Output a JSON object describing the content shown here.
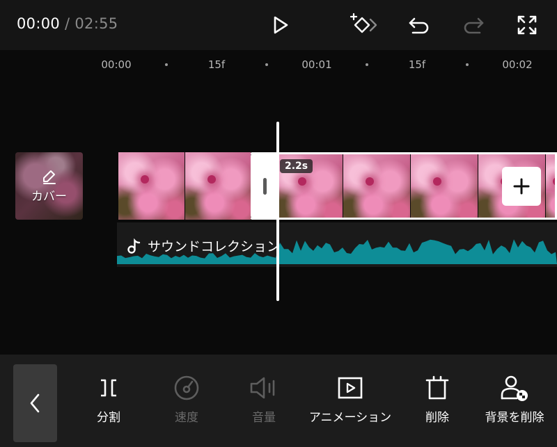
{
  "header": {
    "current_time": "00:00",
    "separator": "/",
    "total_time": "02:55",
    "icons": [
      "play-icon",
      "add-keyframe-icon",
      "undo-icon",
      "redo-icon",
      "fullscreen-icon"
    ]
  },
  "ruler": {
    "labels": [
      "00:00",
      "15f",
      "00:01",
      "15f",
      "00:02"
    ]
  },
  "cover": {
    "label": "カバー",
    "icon": "edit-pencil-icon"
  },
  "video": {
    "duration_badge": "2.2s",
    "add_icon": "plus-icon"
  },
  "audio": {
    "label": "サウンドコレクション",
    "icon": "music-note-icon",
    "wave_color": "#0e8d97"
  },
  "toolbar": {
    "back_icon": "chevron-left-icon",
    "items": [
      {
        "label": "分割",
        "icon": "split-icon",
        "enabled": true
      },
      {
        "label": "速度",
        "icon": "speed-icon",
        "enabled": false
      },
      {
        "label": "音量",
        "icon": "volume-icon",
        "enabled": false
      },
      {
        "label": "アニメーション",
        "icon": "animation-icon",
        "enabled": true
      },
      {
        "label": "削除",
        "icon": "delete-icon",
        "enabled": true
      },
      {
        "label": "背景を削除",
        "icon": "remove-background-icon",
        "enabled": true
      }
    ]
  }
}
